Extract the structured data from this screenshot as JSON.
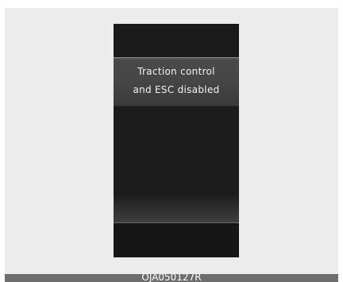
{
  "display": {
    "message": {
      "line1": "Traction control",
      "line2": "and ESC disabled"
    }
  },
  "caption": {
    "code": "OJA050127R"
  },
  "colors": {
    "background": "#ececec",
    "display_bg": "#1b1b1b",
    "message_band": "#454545",
    "message_text": "#f2f2f2",
    "caption_bar": "#6d6d6d"
  }
}
